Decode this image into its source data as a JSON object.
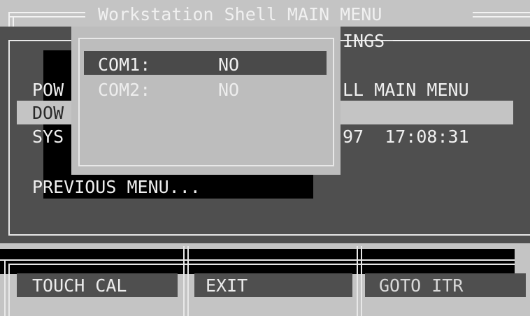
{
  "window": {
    "title": "Workstation Shell MAIN MENU"
  },
  "background_menu": {
    "title_fragment": "INGS",
    "items": [
      {
        "prefix": "POW",
        "suffix": "LL MAIN MENU"
      },
      {
        "prefix": "DOW",
        "suffix": ""
      },
      {
        "prefix": "SYS",
        "suffix": "97  17:08:31"
      }
    ],
    "previous_menu": "PREVIOUS MENU..."
  },
  "popup": {
    "rows": [
      {
        "label": "COM1:",
        "value": "NO",
        "selected": true
      },
      {
        "label": "COM2:",
        "value": "NO",
        "selected": false
      }
    ]
  },
  "bottom_bar": {
    "buttons": [
      {
        "label": "TOUCH CAL"
      },
      {
        "label": "EXIT"
      },
      {
        "label": "GOTO ITR"
      }
    ]
  },
  "colors": {
    "screen_bg": "#c4c4c4",
    "panel_gray": "#4f4f4f",
    "popup_gray": "#bdbdbd",
    "highlight_dark": "#4a4a4a",
    "black": "#000000",
    "text_light": "#f0f0f0"
  }
}
